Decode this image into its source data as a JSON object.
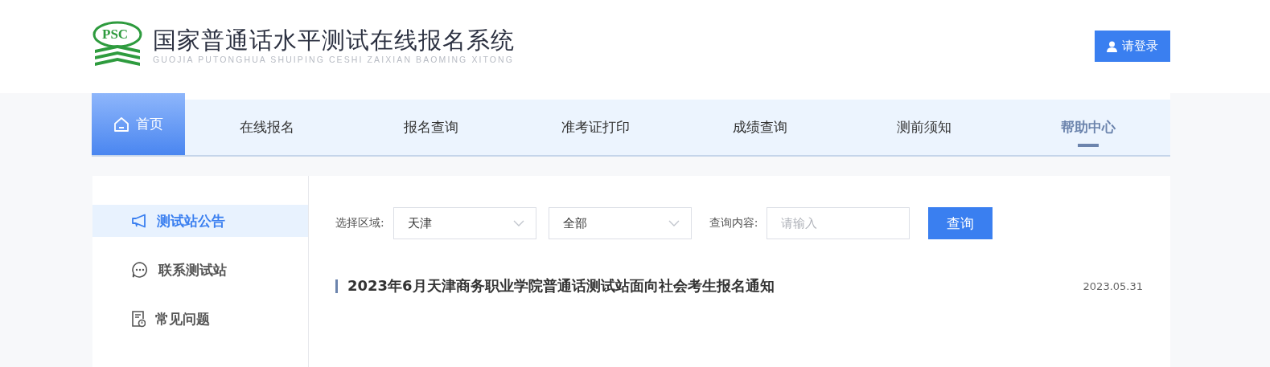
{
  "header": {
    "logo_badge": "PSC",
    "title": "国家普通话水平测试在线报名系统",
    "subtitle": "GUOJIA PUTONGHUA SHUIPING CESHI ZAIXIAN BAOMING XITONG",
    "login_button": "请登录"
  },
  "nav": [
    {
      "label": "首页",
      "selected": true,
      "emphasized": false
    },
    {
      "label": "在线报名",
      "selected": false,
      "emphasized": false
    },
    {
      "label": "报名查询",
      "selected": false,
      "emphasized": false
    },
    {
      "label": "准考证打印",
      "selected": false,
      "emphasized": false
    },
    {
      "label": "成绩查询",
      "selected": false,
      "emphasized": false
    },
    {
      "label": "测前须知",
      "selected": false,
      "emphasized": false
    },
    {
      "label": "帮助中心",
      "selected": false,
      "emphasized": true
    }
  ],
  "sidebar": {
    "items": [
      {
        "label": "测试站公告",
        "kind": "megaphone",
        "selected": true
      },
      {
        "label": "联系测试站",
        "kind": "chat",
        "selected": false
      },
      {
        "label": "常见问题",
        "kind": "document",
        "selected": false
      }
    ]
  },
  "filters": {
    "region_label": "选择区域:",
    "region": "天津",
    "category": "全部",
    "query_label": "查询内容:",
    "query_placeholder": "请输入",
    "search_button": "查询"
  },
  "notices": [
    {
      "title": "2023年6月天津商务职业学院普通话测试站面向社会考生报名通知",
      "date": "2023.05.31"
    }
  ]
}
